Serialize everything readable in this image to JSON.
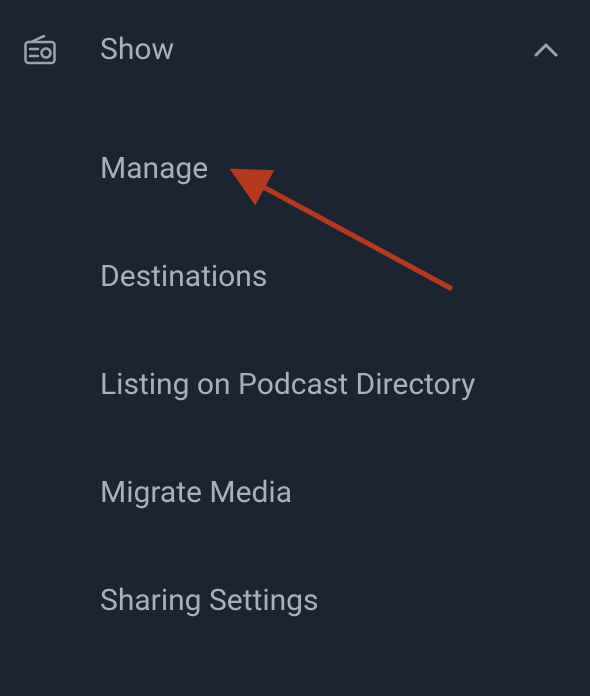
{
  "sidebar": {
    "section": {
      "icon": "radio-icon",
      "title": "Show",
      "expanded": true,
      "items": [
        {
          "label": "Manage"
        },
        {
          "label": "Destinations"
        },
        {
          "label": "Listing on Podcast Directory"
        },
        {
          "label": "Migrate Media"
        },
        {
          "label": "Sharing Settings"
        }
      ]
    }
  },
  "annotation": {
    "arrow_color": "#b33a1e"
  }
}
